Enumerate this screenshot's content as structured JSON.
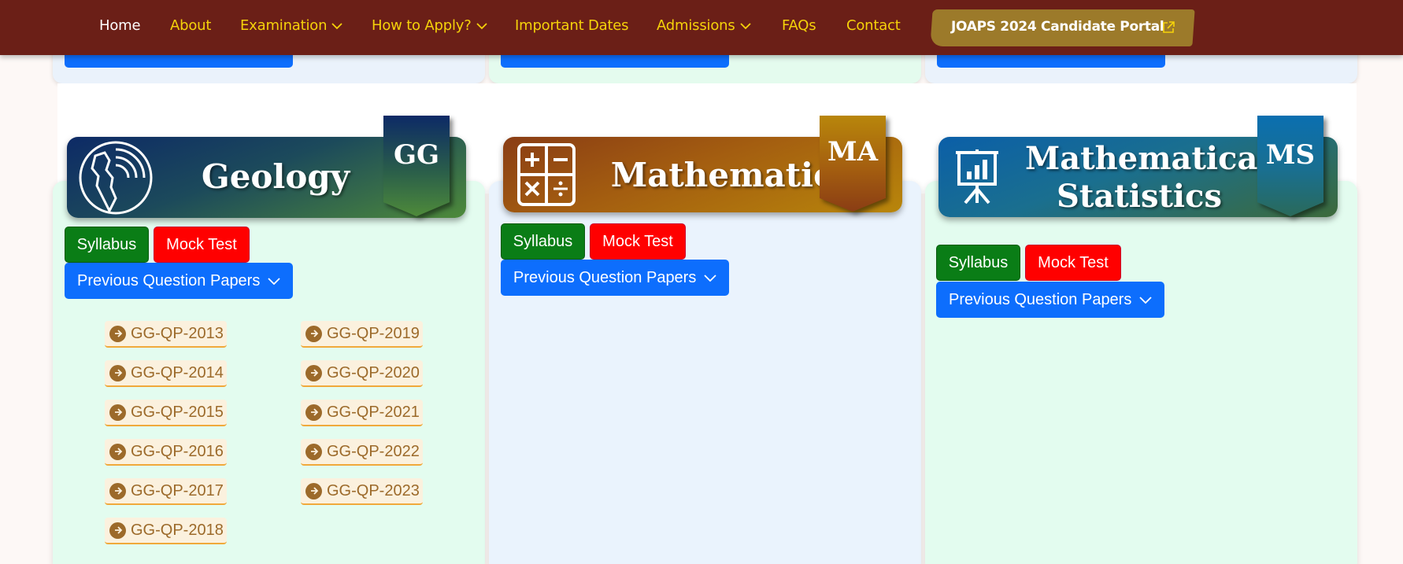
{
  "nav": {
    "home": "Home",
    "about": "About",
    "examination": "Examination",
    "how_to_apply": "How to Apply?",
    "important_dates": "Important Dates",
    "admissions": "Admissions",
    "faqs": "FAQs",
    "contact": "Contact",
    "portal": "JOAPS 2024 Candidate Portal",
    "colors": {
      "bar": "#6b1f17",
      "link": "#f5d20a",
      "active": "#ffffff",
      "portal": "#9c7a2a"
    }
  },
  "subjects": [
    {
      "title": "Geology",
      "code": "GG",
      "icon": "geology-globe-icon",
      "syllabus": "Syllabus",
      "mock_test": "Mock Test",
      "papers_label": "Previous Question Papers",
      "papers": [
        "GG-QP-2013",
        "GG-QP-2014",
        "GG-QP-2015",
        "GG-QP-2016",
        "GG-QP-2017",
        "GG-QP-2018",
        "GG-QP-2019",
        "GG-QP-2020",
        "GG-QP-2021",
        "GG-QP-2022",
        "GG-QP-2023"
      ]
    },
    {
      "title": "Mathematics",
      "code": "MA",
      "icon": "calculator-icon",
      "syllabus": "Syllabus",
      "mock_test": "Mock Test",
      "papers_label": "Previous Question Papers"
    },
    {
      "title_line1": "Mathematical",
      "title_line2": "Statistics",
      "code": "MS",
      "icon": "presentation-chart-icon",
      "syllabus": "Syllabus",
      "mock_test": "Mock Test",
      "papers_label": "Previous Question Papers"
    }
  ],
  "colors": {
    "green_btn": "#0a7d16",
    "red_btn": "#ff0000",
    "blue_btn": "#0d6efd",
    "card_green": "#e3fcef",
    "card_blue": "#eaf3fd"
  }
}
